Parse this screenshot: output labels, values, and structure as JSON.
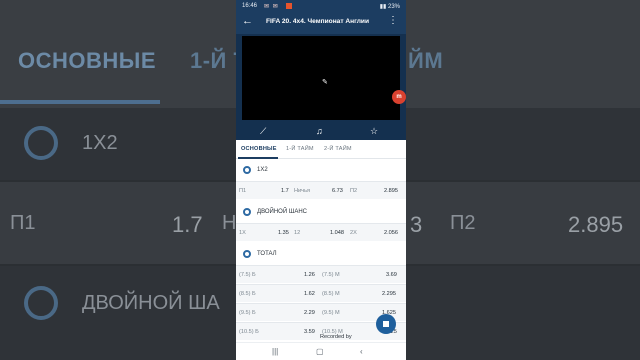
{
  "status_bar": {
    "time": "16:46",
    "battery": "23%"
  },
  "app_bar": {
    "title": "FIFA 20. 4x4. Чемпионат Англии"
  },
  "tabs": [
    "ОСНОВНЫЕ",
    "1-Й ТАЙМ",
    "2-Й ТАЙМ"
  ],
  "markets": {
    "m1x2": {
      "title": "1X2",
      "odds": [
        {
          "label": "П1",
          "value": "1.7"
        },
        {
          "label": "Ничья",
          "value": "6.73"
        },
        {
          "label": "П2",
          "value": "2.895"
        }
      ]
    },
    "double_chance": {
      "title": "ДВОЙНОЙ ШАНС",
      "odds": [
        {
          "label": "1X",
          "value": "1.35"
        },
        {
          "label": "12",
          "value": "1.048"
        },
        {
          "label": "2X",
          "value": "2.056"
        }
      ]
    },
    "total": {
      "title": "ТОТАЛ",
      "rows": [
        {
          "over_label": "(7.5) Б",
          "over_value": "1.26",
          "under_label": "(7.5) М",
          "under_value": "3.69"
        },
        {
          "over_label": "(8.5) Б",
          "over_value": "1.62",
          "under_label": "(8.5) М",
          "under_value": "2.295"
        },
        {
          "over_label": "(9.5) Б",
          "over_value": "2.29",
          "under_label": "(9.5) М",
          "under_value": "1.625"
        },
        {
          "over_label": "(10.5) Б",
          "over_value": "3.59",
          "under_label": "(10.5) М",
          "under_value": "1.25"
        }
      ]
    }
  },
  "background": {
    "tabs": [
      "ОСНОВНЫЕ",
      "1-Й ТА",
      "ЙМ"
    ],
    "section1": "1X2",
    "p1_label": "П1",
    "p1_value": "1.7",
    "draw_partial": "Н",
    "p2_partial_num": "3",
    "p2_label": "П2",
    "p2_value": "2.895",
    "section2": "ДВОЙНОЙ ША"
  },
  "overlay": {
    "recorder_badge": "m",
    "recorded_text": "Recorded by"
  }
}
